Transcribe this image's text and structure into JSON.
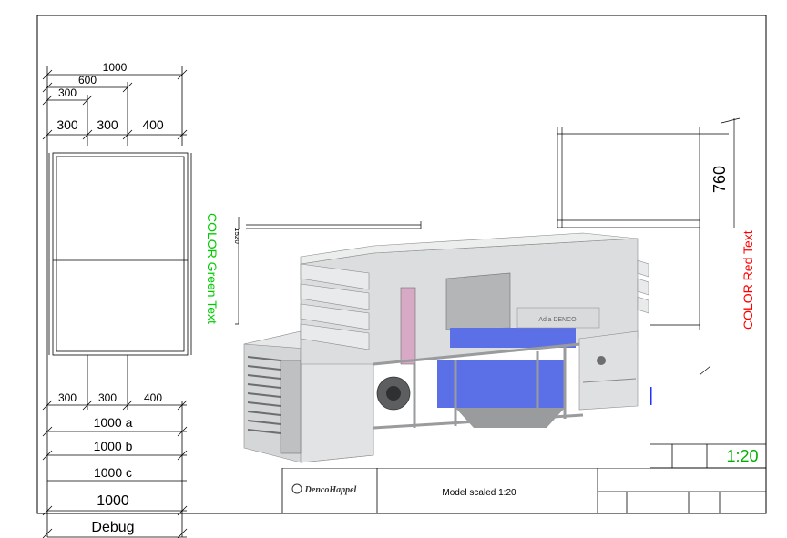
{
  "dimensions_top": {
    "overall": "1000",
    "mid": "600",
    "small": "300",
    "segments": [
      "300",
      "300",
      "400"
    ]
  },
  "dimensions_bottom": {
    "segments": [
      "300",
      "300",
      "400"
    ],
    "rows": [
      "1000 a",
      "1000 b",
      "1000 c",
      "1000"
    ],
    "debug": "Debug"
  },
  "side_view": {
    "height_label": "1520",
    "color_text": "COLOR Green Text",
    "color": "#00cc00"
  },
  "right_view": {
    "height_label": "760",
    "color_text": "COLOR Red Text",
    "color": "#ff0000"
  },
  "title_block": {
    "logo_text": "DencoHappel",
    "model_text": "Model scaled 1:20",
    "scale": "1:20",
    "scale_color": "#00b000"
  },
  "product_image": {
    "nameplate": "Adia DENCO"
  }
}
